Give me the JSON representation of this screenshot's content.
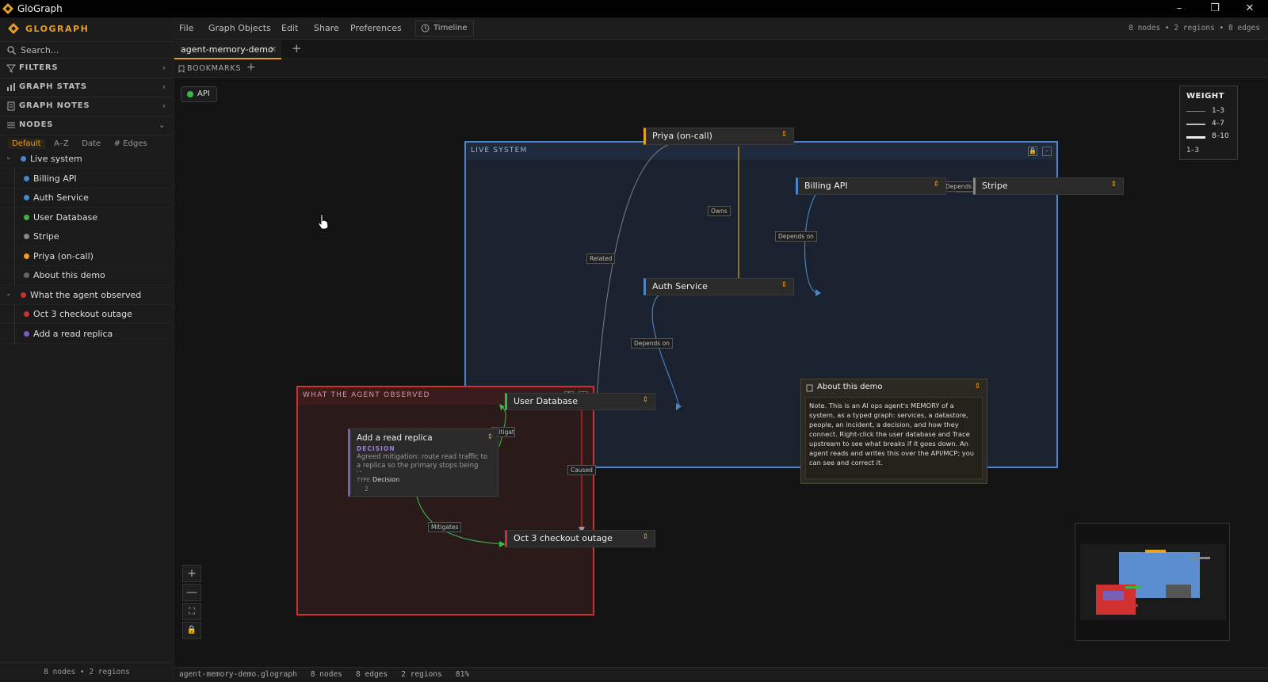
{
  "app": {
    "title": "GloGraph",
    "brand": "GLOGRAPH"
  },
  "window_controls": {
    "minimize": "–",
    "restore": "❐",
    "close": "✕"
  },
  "sidebar": {
    "search_placeholder": "Search...",
    "sections": [
      {
        "label": "FILTERS",
        "icon": "filter-icon"
      },
      {
        "label": "GRAPH STATS",
        "icon": "bar-chart-icon"
      },
      {
        "label": "GRAPH NOTES",
        "icon": "note-icon"
      },
      {
        "label": "NODES",
        "icon": "list-icon"
      }
    ],
    "sort_options": [
      "Default",
      "A–Z",
      "Date",
      "# Edges"
    ],
    "sort_selected": "Default",
    "tree": [
      {
        "label": "Live system",
        "color": "#4a86c8",
        "group": true
      },
      {
        "label": "Billing API",
        "color": "#4a86c8"
      },
      {
        "label": "Auth Service",
        "color": "#4a86c8"
      },
      {
        "label": "User Database",
        "color": "#3bb54a"
      },
      {
        "label": "Stripe",
        "color": "#888888"
      },
      {
        "label": "Priya (on-call)",
        "color": "#e8a020"
      },
      {
        "label": "About this demo",
        "color": "#666666"
      },
      {
        "label": "What the agent observed",
        "color": "#d03030",
        "group": true
      },
      {
        "label": "Oct 3 checkout outage",
        "color": "#d03030"
      },
      {
        "label": "Add a read replica",
        "color": "#7a5fb8"
      }
    ],
    "footer": "8 nodes • 2 regions"
  },
  "menubar": {
    "items": [
      "File",
      "Graph Objects",
      "Edit",
      "Share",
      "Preferences"
    ],
    "timeline": "Timeline",
    "counts": "8 nodes • 2 regions • 8 edges"
  },
  "tabs": {
    "active": "agent-memory-demo",
    "close": "×",
    "add": "+"
  },
  "bookmarks": {
    "label": "BOOKMARKS",
    "add": "+"
  },
  "canvas": {
    "chip": "API",
    "regions": {
      "live": {
        "label": "LIVE SYSTEM"
      },
      "observed": {
        "label": "WHAT THE AGENT OBSERVED"
      }
    },
    "nodes": {
      "priya": "Priya (on-call)",
      "billing": "Billing API",
      "stripe": "Stripe",
      "auth": "Auth Service",
      "userdb": "User Database",
      "outage": "Oct 3 checkout outage"
    },
    "decision_card": {
      "title": "Add a read replica",
      "type_tag": "DECISION",
      "body": "Agreed mitigation: route read traffic to a replica so the primary stops being th...",
      "type_label": "TYPE",
      "type_value": "Decision",
      "count": "2"
    },
    "note_card": {
      "title": "About this demo",
      "body": "Note. This is an AI ops agent's MEMORY of a system, as a typed graph: services, a datastore, people, an incident, a decision, and how they connect. Right-click the user database and Trace upstream to see what breaks if it goes down. An agent reads and writes this over the API/MCP; you can see and correct it."
    },
    "edge_labels": {
      "owns": "Owns",
      "related": "Related",
      "depends1": "Depends on",
      "depends2": "Depends on",
      "depends3": "Depends on",
      "mitigates1": "Mitigates",
      "mitigates2": "Mitigates",
      "caused": "Caused"
    },
    "legend": {
      "title": "WEIGHT",
      "rows": [
        "1–3",
        "4–7",
        "8–10"
      ],
      "footer": "1–3"
    },
    "zoom_controls": [
      "+",
      "—",
      "⛶",
      "🔒"
    ]
  },
  "statusbar": {
    "text": "agent-memory-demo.glograph   8 nodes   8 edges   2 regions   81%"
  },
  "colors": {
    "accent": "#e8a020",
    "live": "#4a86c8",
    "observed": "#d03030",
    "decision": "#7a5fb8",
    "db": "#3bb54a"
  }
}
